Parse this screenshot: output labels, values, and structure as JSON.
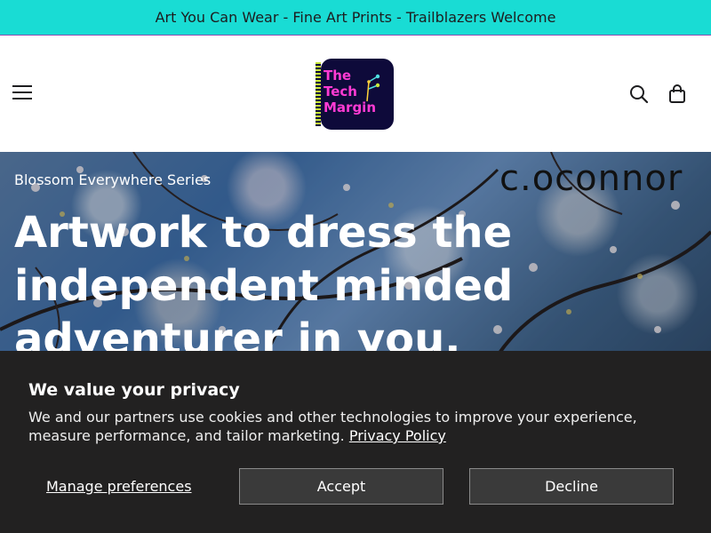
{
  "announcement": {
    "text": "Art You Can Wear - Fine Art Prints - Trailblazers Welcome",
    "background": "#19dcd4"
  },
  "header": {
    "menu_icon": "hamburger-icon",
    "logo": {
      "lines": [
        "The",
        "Tech",
        "Margin"
      ],
      "background": "#0e0a3a",
      "text_color": "#ff3bd4"
    },
    "search_icon": "search-icon",
    "cart_icon": "shopping-bag-icon"
  },
  "hero": {
    "kicker": "Blossom Everywhere Series",
    "heading": "Artwork to dress the independent minded adventurer in you.",
    "signature": "c.oconnor"
  },
  "cookie_banner": {
    "title": "We value your privacy",
    "text": "We and our partners use cookies and other technologies to improve your experience, measure performance, and tailor marketing.",
    "policy_link": "Privacy Policy",
    "manage_label": "Manage preferences",
    "accept_label": "Accept",
    "decline_label": "Decline",
    "background": "#222121"
  }
}
